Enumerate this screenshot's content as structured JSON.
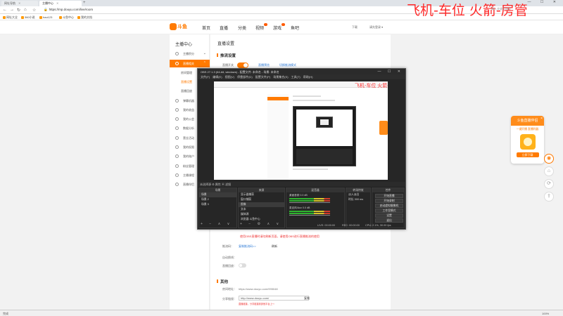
{
  "browser": {
    "tabs": [
      {
        "label": "网址导航"
      },
      {
        "label": "主播中心"
      }
    ],
    "new_tab": "+",
    "window_controls": "— ☐ ✕",
    "url": "https://mp.douyu.com/live/room",
    "bookmarks": [
      "网址大全",
      "360小说",
      "hao123",
      "斗鱼中心",
      "我的文档"
    ]
  },
  "overlay": {
    "text": "飞机-车位  火箭-房管",
    "sub": "输入关键字搜索"
  },
  "site": {
    "logo": "斗鱼",
    "nav": [
      "首页",
      "直播",
      "分类",
      "视频",
      "游戏",
      "鱼吧"
    ],
    "user": [
      "下载",
      "请先登录 ▾"
    ]
  },
  "sidebar": {
    "title": "主播中心",
    "items": [
      {
        "label": "主播积分"
      },
      {
        "label": "直播相关"
      },
      {
        "label": "房间管理"
      },
      {
        "label": "直播设置"
      },
      {
        "label": "直播回放"
      },
      {
        "label": "弹幕机器"
      },
      {
        "label": "我的收益"
      },
      {
        "label": "我的公会"
      },
      {
        "label": "数据分析"
      },
      {
        "label": "营业活动"
      },
      {
        "label": "我的权限"
      },
      {
        "label": "我的账户"
      },
      {
        "label": "粉丝管理"
      },
      {
        "label": "主播课程"
      },
      {
        "label": "直播伴侣"
      }
    ]
  },
  "main": {
    "page_title": "直播设置",
    "section1": "推流设置",
    "live_switch_label": "直播开关",
    "links": [
      "直播预览",
      "切换推流模式"
    ],
    "warning": "使用OBS直播时请勿刷新页面，请使用OBS进行直播推流的使用",
    "stream_code_label": "推流码：",
    "stream_code_link": "复制推流码>>",
    "stream_code_btn": "刷新",
    "auto_label": "自动换线：",
    "auto_label2": "直播回放：",
    "section2": "其他",
    "room_url_label": "房间地址：",
    "room_url": "https://www.douyu.com/995048",
    "share_label": "分享链接：",
    "share_value": "http://www.douyu.com/",
    "share_btn": "复制",
    "share_note": "直播链接，分享链接到其他平台上～"
  },
  "obs": {
    "title": "OBS 27.1.3 (64-bit, windows) - 配置文件: 未命名 - 场景: 未命名",
    "menu": "文件(F)  编辑(E)  视图(V)  停靠部件(D)  配置文件(P)  场景集合(S)  工具(T)  帮助(H)",
    "nested_overlay": "飞机-车位  火箭-房管",
    "context": "未选择源     ⚙ 属性     ▣ 滤镜",
    "docks": {
      "scenes": {
        "title": "场景",
        "rows": [
          "场景",
          "场景 2",
          "场景 3"
        ]
      },
      "sources": {
        "title": "来源",
        "rows": [
          "显示器捕获",
          "窗口捕获",
          "图像",
          "文本",
          "媒体源",
          "浏览器 斗鱼中心"
        ]
      },
      "mixer": {
        "title": "混音器",
        "channels": [
          "桌面音频  0.0 dB",
          "麦克风/Aux  0.0 dB"
        ]
      },
      "transitions": {
        "title": "转场特效",
        "type": "淡入淡出",
        "duration_label": "时长",
        "duration": "300 ms"
      },
      "controls": {
        "title": "控件",
        "buttons": [
          "开始直播",
          "开始录制",
          "启动虚拟摄像机",
          "工作室模式",
          "设置",
          "退出"
        ]
      }
    },
    "status": [
      "LIVE: 00:00:00",
      "REC: 00:00:00",
      "CPU: 2.1%, 30.00 fps"
    ]
  },
  "promo": {
    "title": "斗鱼直播伴侣",
    "subtitle": "一键开播 直播利器",
    "button": "立即下载",
    "close": "×"
  },
  "statusbar": {
    "left": "完成",
    "right": [
      "100%"
    ]
  },
  "colors": {
    "brand": "#ff7a00",
    "overlay": "#ff2a2a",
    "link": "#2d7ad6"
  }
}
